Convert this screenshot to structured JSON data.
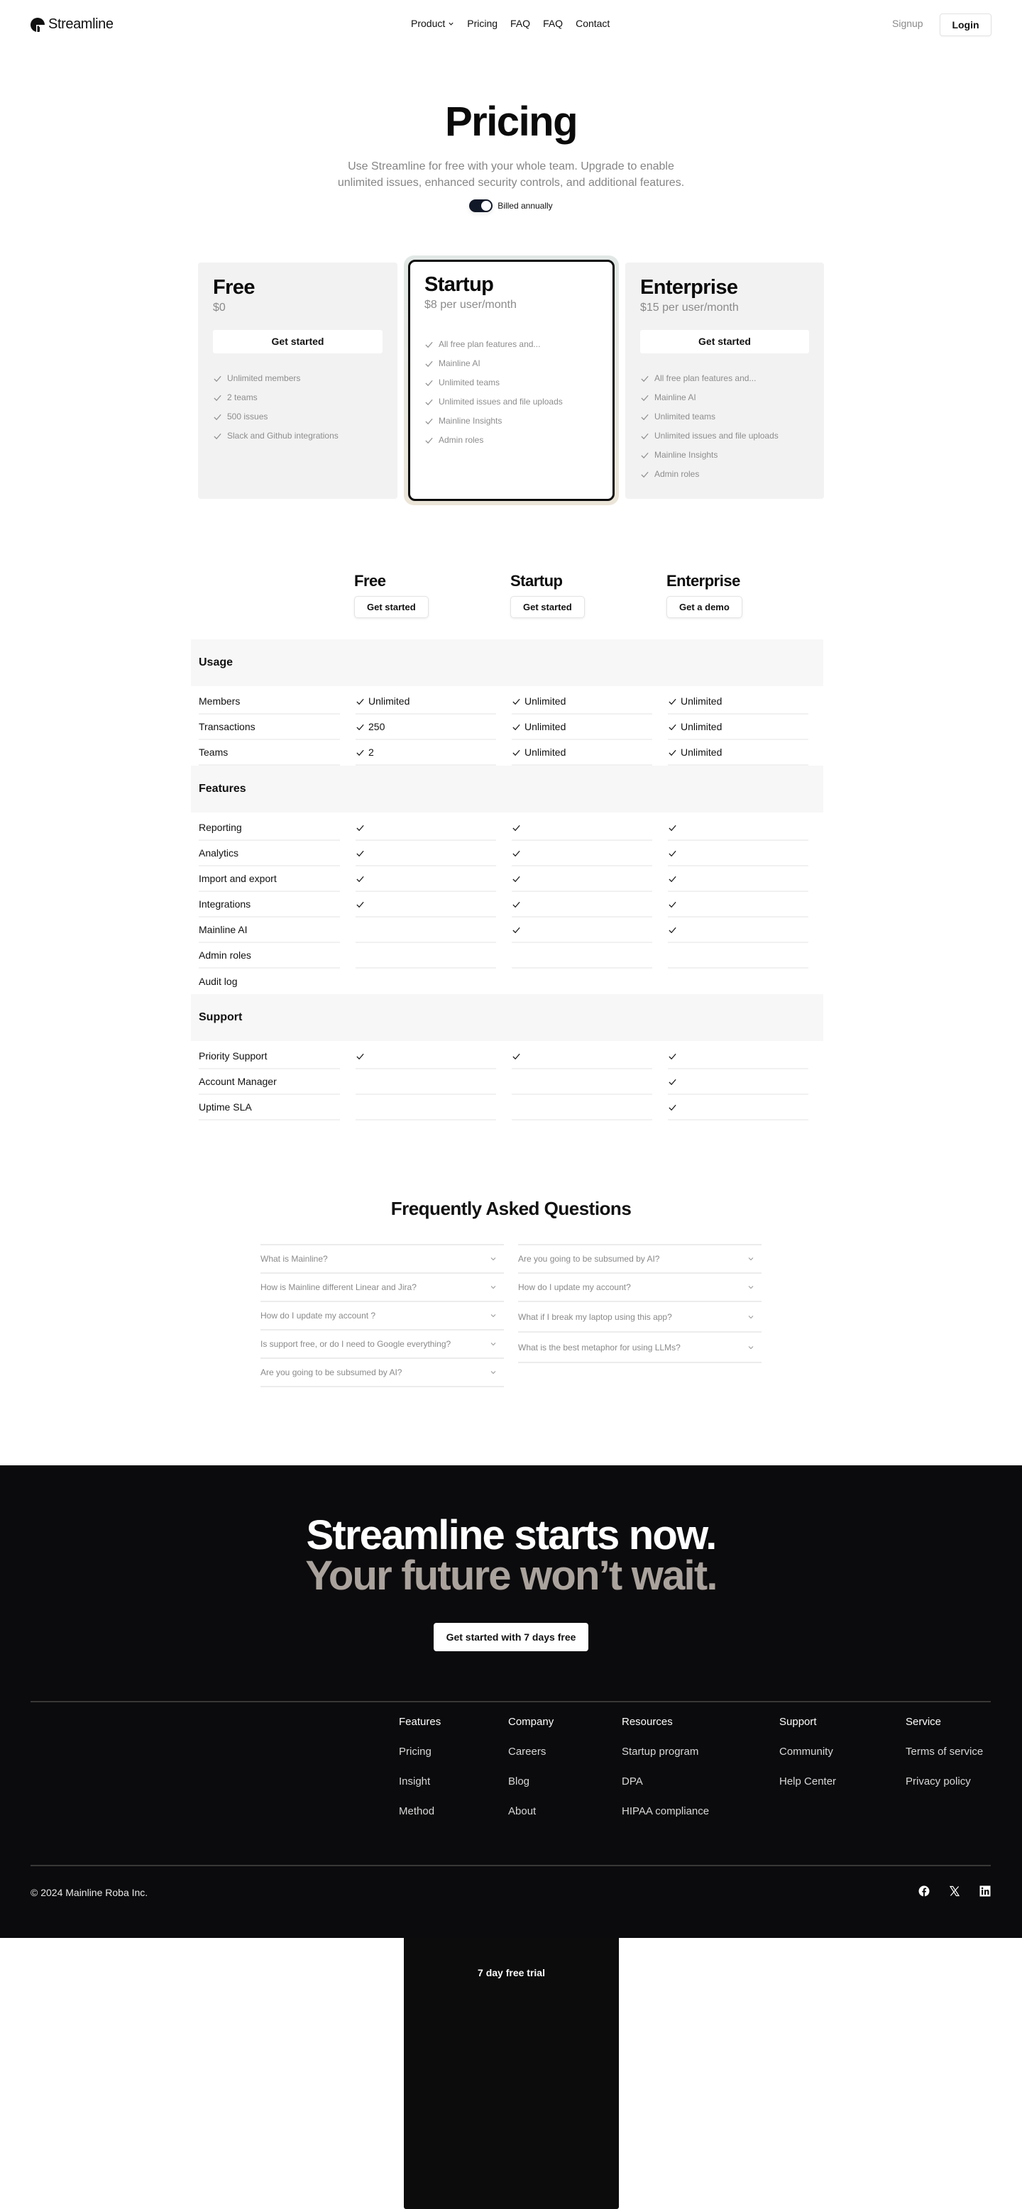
{
  "nav": {
    "brand": "Streamline",
    "links": [
      {
        "label": "Product",
        "has_dropdown": true
      },
      {
        "label": "Pricing"
      },
      {
        "label": "FAQ"
      },
      {
        "label": "FAQ"
      },
      {
        "label": "Contact"
      }
    ],
    "signup": "Signup",
    "login": "Login"
  },
  "hero": {
    "title": "Pricing",
    "subtitle": "Use Streamline for free with your whole team. Upgrade to enable unlimited issues, enhanced security controls, and additional features.",
    "billing_toggle": {
      "label": "Billed annually",
      "on": true
    }
  },
  "plans": [
    {
      "name": "Free",
      "price": "$0",
      "cta": "Get started",
      "highlighted": false,
      "features": [
        "Unlimited members",
        "2 teams",
        "500 issues",
        "Slack and Github integrations"
      ]
    },
    {
      "name": "Startup",
      "price": "$8 per user/month",
      "cta": "7 day free trial",
      "highlighted": true,
      "features": [
        "All free plan features and...",
        "Mainline AI",
        "Unlimited teams",
        "Unlimited issues and file uploads",
        "Mainline Insights",
        "Admin roles"
      ]
    },
    {
      "name": "Enterprise",
      "price": "$15 per user/month",
      "cta": "Get started",
      "highlighted": false,
      "features": [
        "All free plan features and...",
        "Mainline AI",
        "Unlimited teams",
        "Unlimited issues and file uploads",
        "Mainline Insights",
        "Admin roles"
      ]
    }
  ],
  "comparison": {
    "columns": [
      {
        "name": "Free",
        "cta": "Get started"
      },
      {
        "name": "Startup",
        "cta": "Get started"
      },
      {
        "name": "Enterprise",
        "cta": "Get a demo"
      }
    ],
    "sections": [
      {
        "title": "Usage",
        "rows": [
          {
            "label": "Members",
            "values": [
              {
                "check": true,
                "text": "Unlimited"
              },
              {
                "check": true,
                "text": "Unlimited"
              },
              {
                "check": true,
                "text": "Unlimited"
              }
            ]
          },
          {
            "label": "Transactions",
            "values": [
              {
                "check": true,
                "text": "250"
              },
              {
                "check": true,
                "text": "Unlimited"
              },
              {
                "check": true,
                "text": "Unlimited"
              }
            ]
          },
          {
            "label": "Teams",
            "values": [
              {
                "check": true,
                "text": "2"
              },
              {
                "check": true,
                "text": "Unlimited"
              },
              {
                "check": true,
                "text": "Unlimited"
              }
            ]
          }
        ]
      },
      {
        "title": "Features",
        "rows": [
          {
            "label": "Reporting",
            "values": [
              {
                "check": true,
                "text": ""
              },
              {
                "check": true,
                "text": ""
              },
              {
                "check": true,
                "text": ""
              }
            ]
          },
          {
            "label": "Analytics",
            "values": [
              {
                "check": true,
                "text": ""
              },
              {
                "check": true,
                "text": ""
              },
              {
                "check": true,
                "text": ""
              }
            ]
          },
          {
            "label": "Import and export",
            "values": [
              {
                "check": true,
                "text": ""
              },
              {
                "check": true,
                "text": ""
              },
              {
                "check": true,
                "text": ""
              }
            ]
          },
          {
            "label": "Integrations",
            "values": [
              {
                "check": true,
                "text": ""
              },
              {
                "check": true,
                "text": ""
              },
              {
                "check": true,
                "text": ""
              }
            ]
          },
          {
            "label": "Mainline AI",
            "values": [
              {
                "check": false,
                "text": ""
              },
              {
                "check": true,
                "text": ""
              },
              {
                "check": true,
                "text": ""
              }
            ]
          },
          {
            "label": "Admin roles",
            "values": [
              {
                "check": false,
                "text": ""
              },
              {
                "check": false,
                "text": ""
              },
              {
                "check": false,
                "text": ""
              }
            ]
          },
          {
            "label": "Audit log",
            "values": [
              {
                "check": false,
                "text": ""
              },
              {
                "check": false,
                "text": ""
              },
              {
                "check": false,
                "text": ""
              }
            ]
          }
        ]
      },
      {
        "title": "Support",
        "rows": [
          {
            "label": "Priority Support",
            "values": [
              {
                "check": true,
                "text": ""
              },
              {
                "check": true,
                "text": ""
              },
              {
                "check": true,
                "text": ""
              }
            ]
          },
          {
            "label": "Account Manager",
            "values": [
              {
                "check": false,
                "text": ""
              },
              {
                "check": false,
                "text": ""
              },
              {
                "check": true,
                "text": ""
              }
            ]
          },
          {
            "label": "Uptime SLA",
            "values": [
              {
                "check": false,
                "text": ""
              },
              {
                "check": false,
                "text": ""
              },
              {
                "check": true,
                "text": ""
              }
            ]
          }
        ]
      }
    ]
  },
  "faq": {
    "title": "Frequently Asked Questions",
    "left": [
      "What is Mainline?",
      "How is Mainline different Linear and Jira?",
      "How do I update my account ?",
      "Is support free, or do I need to Google everything?",
      "Are you going to be subsumed by AI?"
    ],
    "right": [
      "Are you going to be subsumed by AI?",
      "How do I update my account?",
      "What if I break my laptop using this app?",
      "What is the best metaphor for using LLMs?"
    ]
  },
  "cta": {
    "line1": "Streamline starts now.",
    "line2": "Your future won’t wait.",
    "button": "Get started with 7 days free"
  },
  "footer": {
    "columns": [
      {
        "title": "Features",
        "links": [
          "Pricing",
          "Insight",
          "Method"
        ]
      },
      {
        "title": "Company",
        "links": [
          "Careers",
          "Blog",
          "About"
        ]
      },
      {
        "title": "Resources",
        "links": [
          "Startup program",
          "DPA",
          "HIPAA compliance"
        ]
      },
      {
        "title": "Support",
        "links": [
          "Community",
          "Help Center"
        ]
      },
      {
        "title": "Service",
        "links": [
          "Terms of service",
          "Privacy policy"
        ]
      }
    ],
    "copyright": "© 2024 Mainline Roba Inc.",
    "socials": [
      "facebook-icon",
      "x-icon",
      "linkedin-icon"
    ]
  },
  "colors": {
    "accent_dark": "#0c0c0c",
    "card_bg": "#f2f2f2",
    "muted_text": "#8a8a8a",
    "footer_bg": "#0b0b0d",
    "cta_secondary": "#aaa29c",
    "toggle_on": "#111827"
  }
}
